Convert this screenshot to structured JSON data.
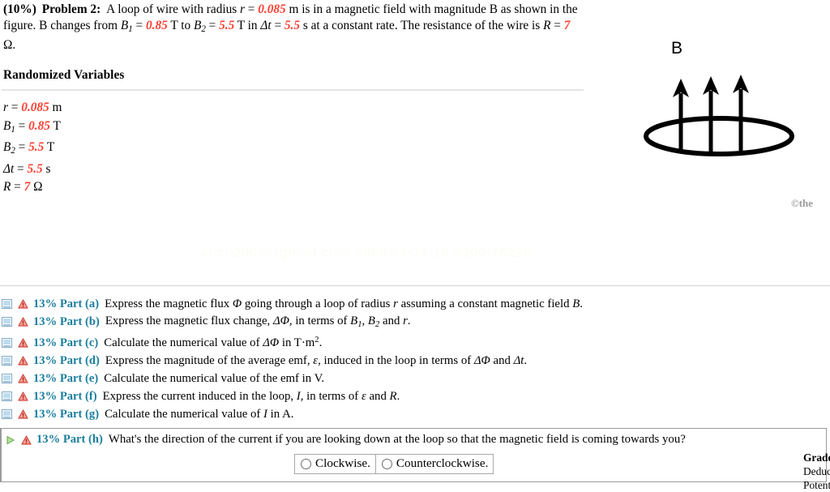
{
  "problem": {
    "weight": "(10%)",
    "title": "Problem 2:",
    "statement_line1_a": "A loop of wire with radius ",
    "statement_r_sym": "r",
    "statement_eq1": " = ",
    "r_value": "0.085",
    "statement_line1_b": " m is in a magnetic field with magnitude B",
    "statement_line2_a": "as shown in the figure. B changes from ",
    "b1_sym": "B",
    "b1_sub": "1",
    "b1_value": "0.85",
    "unit_T": " T to ",
    "b2_sym": "B",
    "b2_sub": "2",
    "b2_value": "5.5",
    "unit_T2": " T in ",
    "dt_sym": "Δt",
    "dt_value": "5.5",
    "statement_line2_b": " s at a constant rate. The",
    "statement_line3_a": "resistance of the wire is ",
    "r_res_sym": "R",
    "r_res_value": "7",
    "ohm": " Ω."
  },
  "randomized": {
    "heading": "Randomized Variables",
    "rows": [
      {
        "sym": "r",
        "sub": "",
        "value": "0.085",
        "unit": "m"
      },
      {
        "sym": "B",
        "sub": "1",
        "value": "0.85",
        "unit": "T"
      },
      {
        "sym": "B",
        "sub": "2",
        "value": "5.5",
        "unit": "T"
      },
      {
        "sym": "Δt",
        "sub": "",
        "value": "5.5",
        "unit": "s"
      },
      {
        "sym": "R",
        "sub": "",
        "value": "7",
        "unit": "Ω"
      }
    ]
  },
  "figure": {
    "b_label": "B",
    "copyright": "©the",
    "arrow_count": 3,
    "description": "circular wire loop drawn in perspective as an ellipse with three upward magnetic field arrows"
  },
  "watermark": {
    "email_text": "encn2007@gmail.com 4989-83-33-16-8200-76226"
  },
  "parts": [
    {
      "id": "a",
      "percent": "13%",
      "label": "13%  Part (a)",
      "text_html": "Express the magnetic flux <i>Φ</i> going through a loop of radius <i>r</i> assuming a constant magnetic field <i>B</i>.",
      "status_icon": "warning-triangle-icon",
      "expand_icon": "collapsed-section-icon",
      "active": false
    },
    {
      "id": "b",
      "percent": "13%",
      "label": "13%  Part (b)",
      "text_html": "Express the magnetic flux change, <i>ΔΦ</i>, in terms of <i>B</i><sub>1</sub>, <i>B</i><sub>2</sub> and <i>r</i>.",
      "status_icon": "warning-triangle-icon",
      "expand_icon": "collapsed-section-icon",
      "active": false
    },
    {
      "id": "c",
      "percent": "13%",
      "label": "13%  Part (c)",
      "text_html": "Calculate the numerical value of <i>ΔΦ</i> in T·m<sup>2</sup>.",
      "status_icon": "warning-triangle-icon",
      "expand_icon": "collapsed-section-icon",
      "active": false
    },
    {
      "id": "d",
      "percent": "13%",
      "label": "13%  Part (d)",
      "text_html": "Express the magnitude of the average emf, <i>ε</i>, induced in the loop in terms of <i>ΔΦ</i> and <i>Δt</i>.",
      "status_icon": "warning-triangle-icon",
      "expand_icon": "collapsed-section-icon",
      "active": false
    },
    {
      "id": "e",
      "percent": "13%",
      "label": "13%  Part (e)",
      "text_html": "Calculate the numerical value of the emf in V.",
      "status_icon": "warning-triangle-icon",
      "expand_icon": "collapsed-section-icon",
      "active": false
    },
    {
      "id": "f",
      "percent": "13%",
      "label": "13%  Part (f)",
      "text_html": "Express the current induced in the loop, <i>I</i>, in terms of <i>ε</i> and <i>R</i>.",
      "status_icon": "warning-triangle-icon",
      "expand_icon": "collapsed-section-icon",
      "active": false
    },
    {
      "id": "g",
      "percent": "13%",
      "label": "13%  Part (g)",
      "text_html": "Calculate the numerical value of <i>I</i> in A.",
      "status_icon": "warning-triangle-icon",
      "expand_icon": "collapsed-section-icon",
      "active": false
    }
  ],
  "active_part": {
    "id": "h",
    "percent": "13%",
    "label": "13%  Part (h)",
    "text_html": "What's the direction of the current if you are looking down at the loop so that the magnetic field is coming towards you?",
    "status_icon": "warning-triangle-icon",
    "expand_icon": "expanded-play-icon",
    "choices": [
      {
        "label": "Clockwise.",
        "selected": false
      },
      {
        "label": "Counterclockwise.",
        "selected": false
      }
    ]
  },
  "grade_summary": {
    "title": "Grade Summary",
    "line2": "Deductions",
    "line3": "Potential"
  },
  "colors": {
    "value_red": "#ff4033",
    "part_teal": "#1b7e9e",
    "warning_red": "#e05548",
    "play_green": "#6fbf4f",
    "icon_blue": "#9cc4dd",
    "rule_gray": "#d6d6d6"
  }
}
